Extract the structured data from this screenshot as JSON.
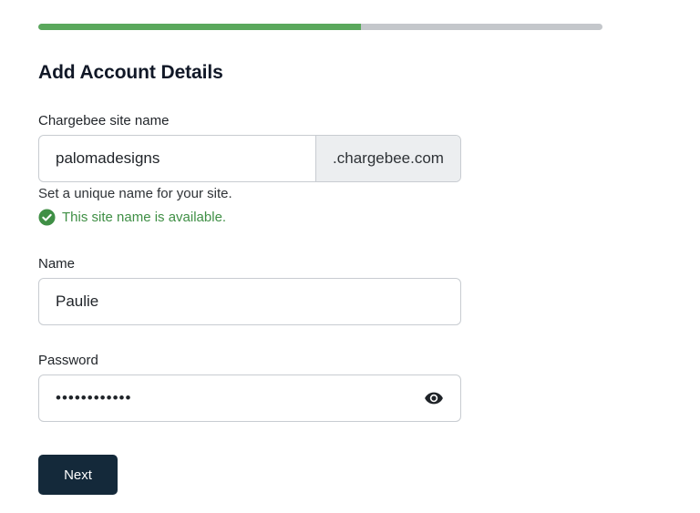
{
  "progress": {
    "fraction": 0.572,
    "fill_color": "#5aa85c",
    "track_color": "#c4c7cb"
  },
  "form": {
    "title": "Add Account Details",
    "site": {
      "label": "Chargebee site name",
      "value": "palomadesigns",
      "suffix": ".chargebee.com",
      "hint": "Set a unique name for your site.",
      "availability": "This site name is available.",
      "availability_icon": "check-circle-icon",
      "availability_color": "#3f8f45"
    },
    "name": {
      "label": "Name",
      "value": "Paulie"
    },
    "password": {
      "label": "Password",
      "value": "••••••••••••",
      "toggle_icon": "eye-icon"
    },
    "next_label": "Next",
    "button_color": "#14293a"
  }
}
